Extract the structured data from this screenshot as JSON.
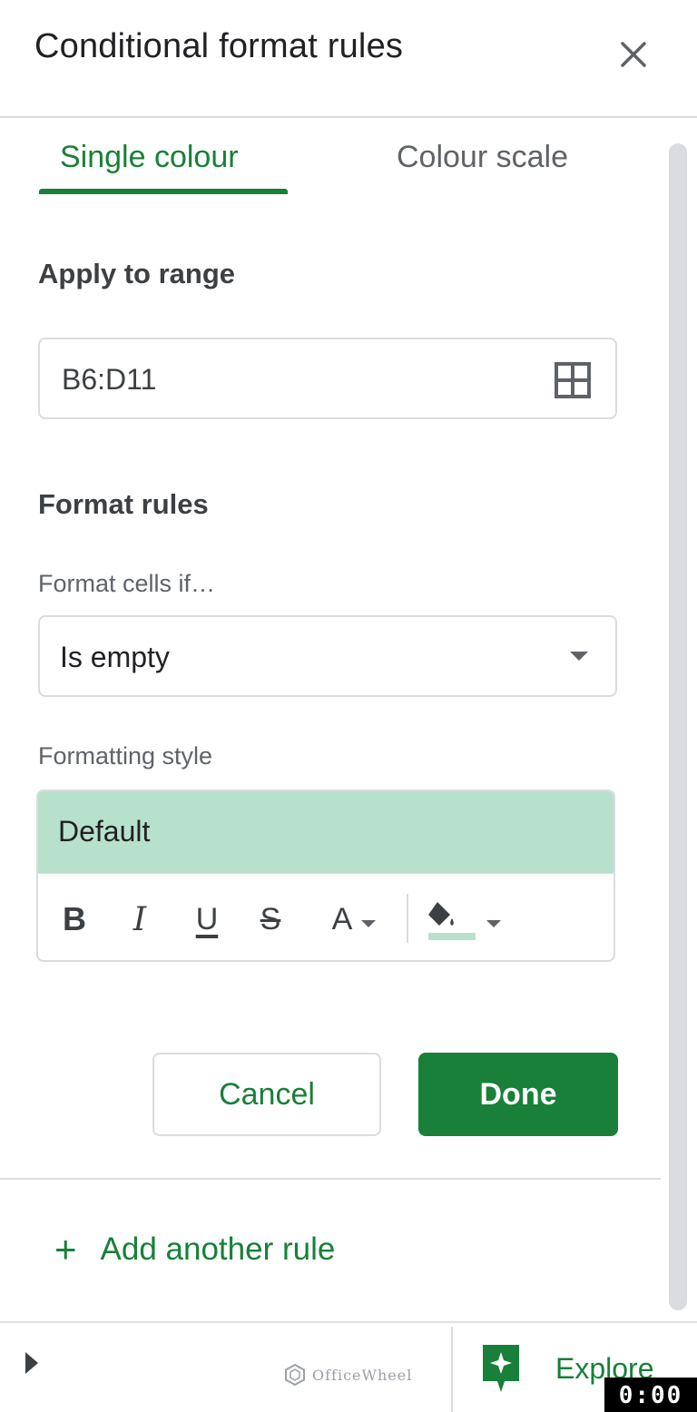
{
  "header": {
    "title": "Conditional format rules",
    "close_icon": "close-icon"
  },
  "tabs": [
    {
      "label": "Single colour",
      "active": true
    },
    {
      "label": "Colour scale",
      "active": false
    }
  ],
  "apply_range": {
    "label": "Apply to range",
    "value": "B6:D11",
    "icon": "grid-select-icon"
  },
  "format_rules": {
    "label": "Format rules",
    "condition_label": "Format cells if…",
    "condition_value": "Is empty",
    "style_label": "Formatting style",
    "style_preview_text": "Default",
    "style_preview_color": "#b7e1cd",
    "toolbar": {
      "bold": "B",
      "italic": "I",
      "underline": "U",
      "strikethrough": "S",
      "text_color": "A"
    }
  },
  "actions": {
    "cancel": "Cancel",
    "done": "Done"
  },
  "add_rule": {
    "label": "Add another rule",
    "icon": "plus-icon"
  },
  "footer": {
    "watermark": "OfficeWheel",
    "explore": "Explore",
    "timer": "0:00"
  },
  "colors": {
    "accent": "#188038",
    "border": "#dadce0",
    "text": "#202124",
    "muted": "#5f6368"
  }
}
